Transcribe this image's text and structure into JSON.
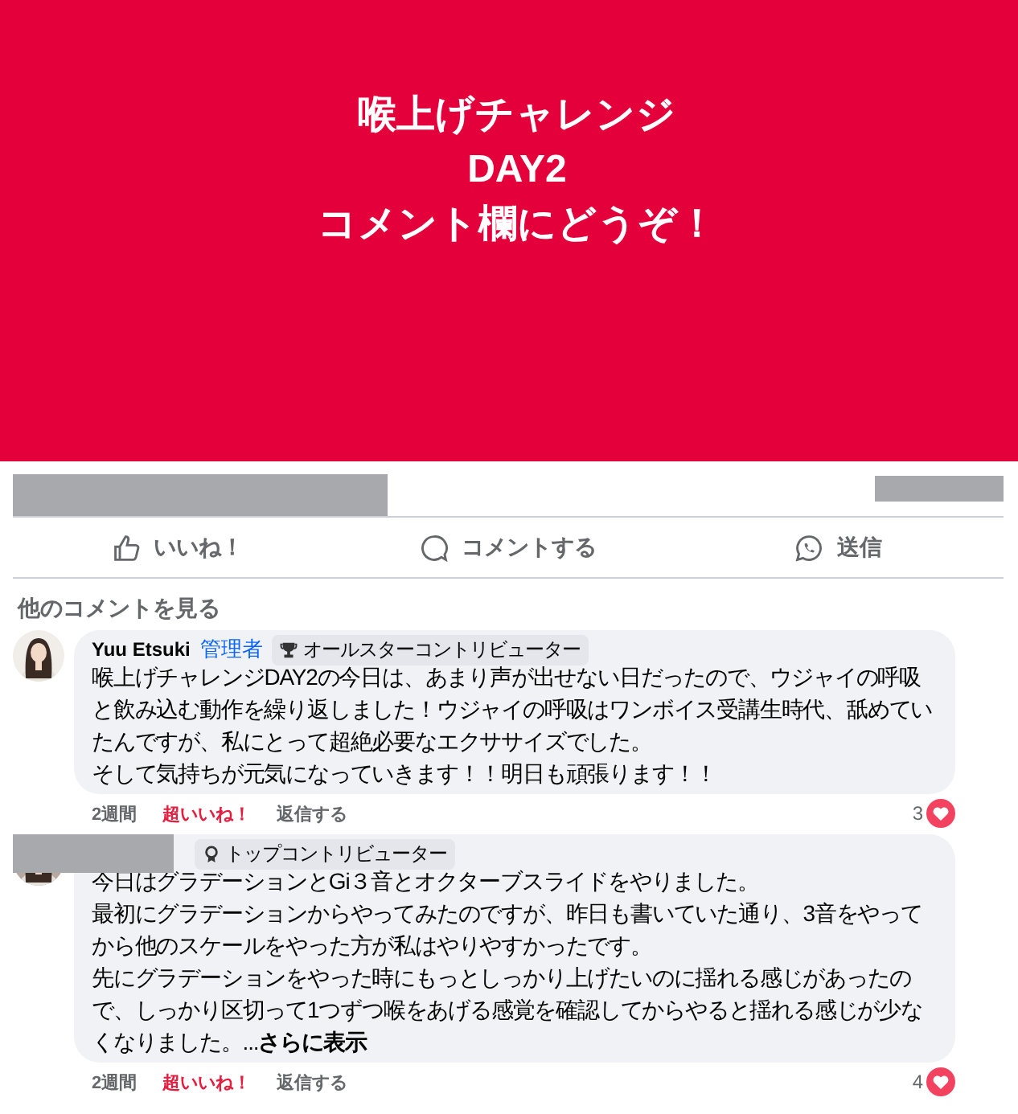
{
  "banner": {
    "title_lines": [
      "喉上げチャレンジ",
      "DAY2",
      "コメント欄にどうぞ！"
    ]
  },
  "actions": [
    {
      "kind": "like",
      "label": "いいね！"
    },
    {
      "kind": "comment",
      "label": "コメントする"
    },
    {
      "kind": "send",
      "label": "送信"
    }
  ],
  "more_comments": "他のコメントを見る",
  "comments": [
    {
      "author": "Yuu Etsuki",
      "role": "管理者",
      "badge": {
        "kind": "trophy",
        "label": "オールスターコントリビューター"
      },
      "paragraphs": [
        "喉上げチャレンジDAY2の今日は、あまり声が出せない日だったので、ウジャイの呼吸と飲み込む動作を繰り返しました！ウジャイの呼吸はワンボイス受講生時代、舐めていたんですが、私にとって超絶必要なエクササイズでした。",
        "そして気持ちが元気になっていきます！！明日も頑張ります！！"
      ],
      "time": "2週間",
      "reaction": "超いいね！",
      "reply": "返信する",
      "count": "3"
    },
    {
      "badge": {
        "kind": "medal",
        "label": "トップコントリビューター"
      },
      "paragraphs": [
        "今日はグラデーションとGi３音とオクターブスライドをやりました。",
        "最初にグラデーションからやってみたのですが、昨日も書いていた通り、3音をやってから他のスケールをやった方が私はやりやすかったです。",
        "先にグラデーションをやった時にもっとしっかり上げたいのに揺れる感じがあったので、しっかり区切って1つずつ喉をあげる感覚を確認してからやると揺れる感じが少なくなりました。..."
      ],
      "more": "さらに表示",
      "time": "2週間",
      "reaction": "超いいね！",
      "reply": "返信する",
      "count": "4"
    }
  ]
}
